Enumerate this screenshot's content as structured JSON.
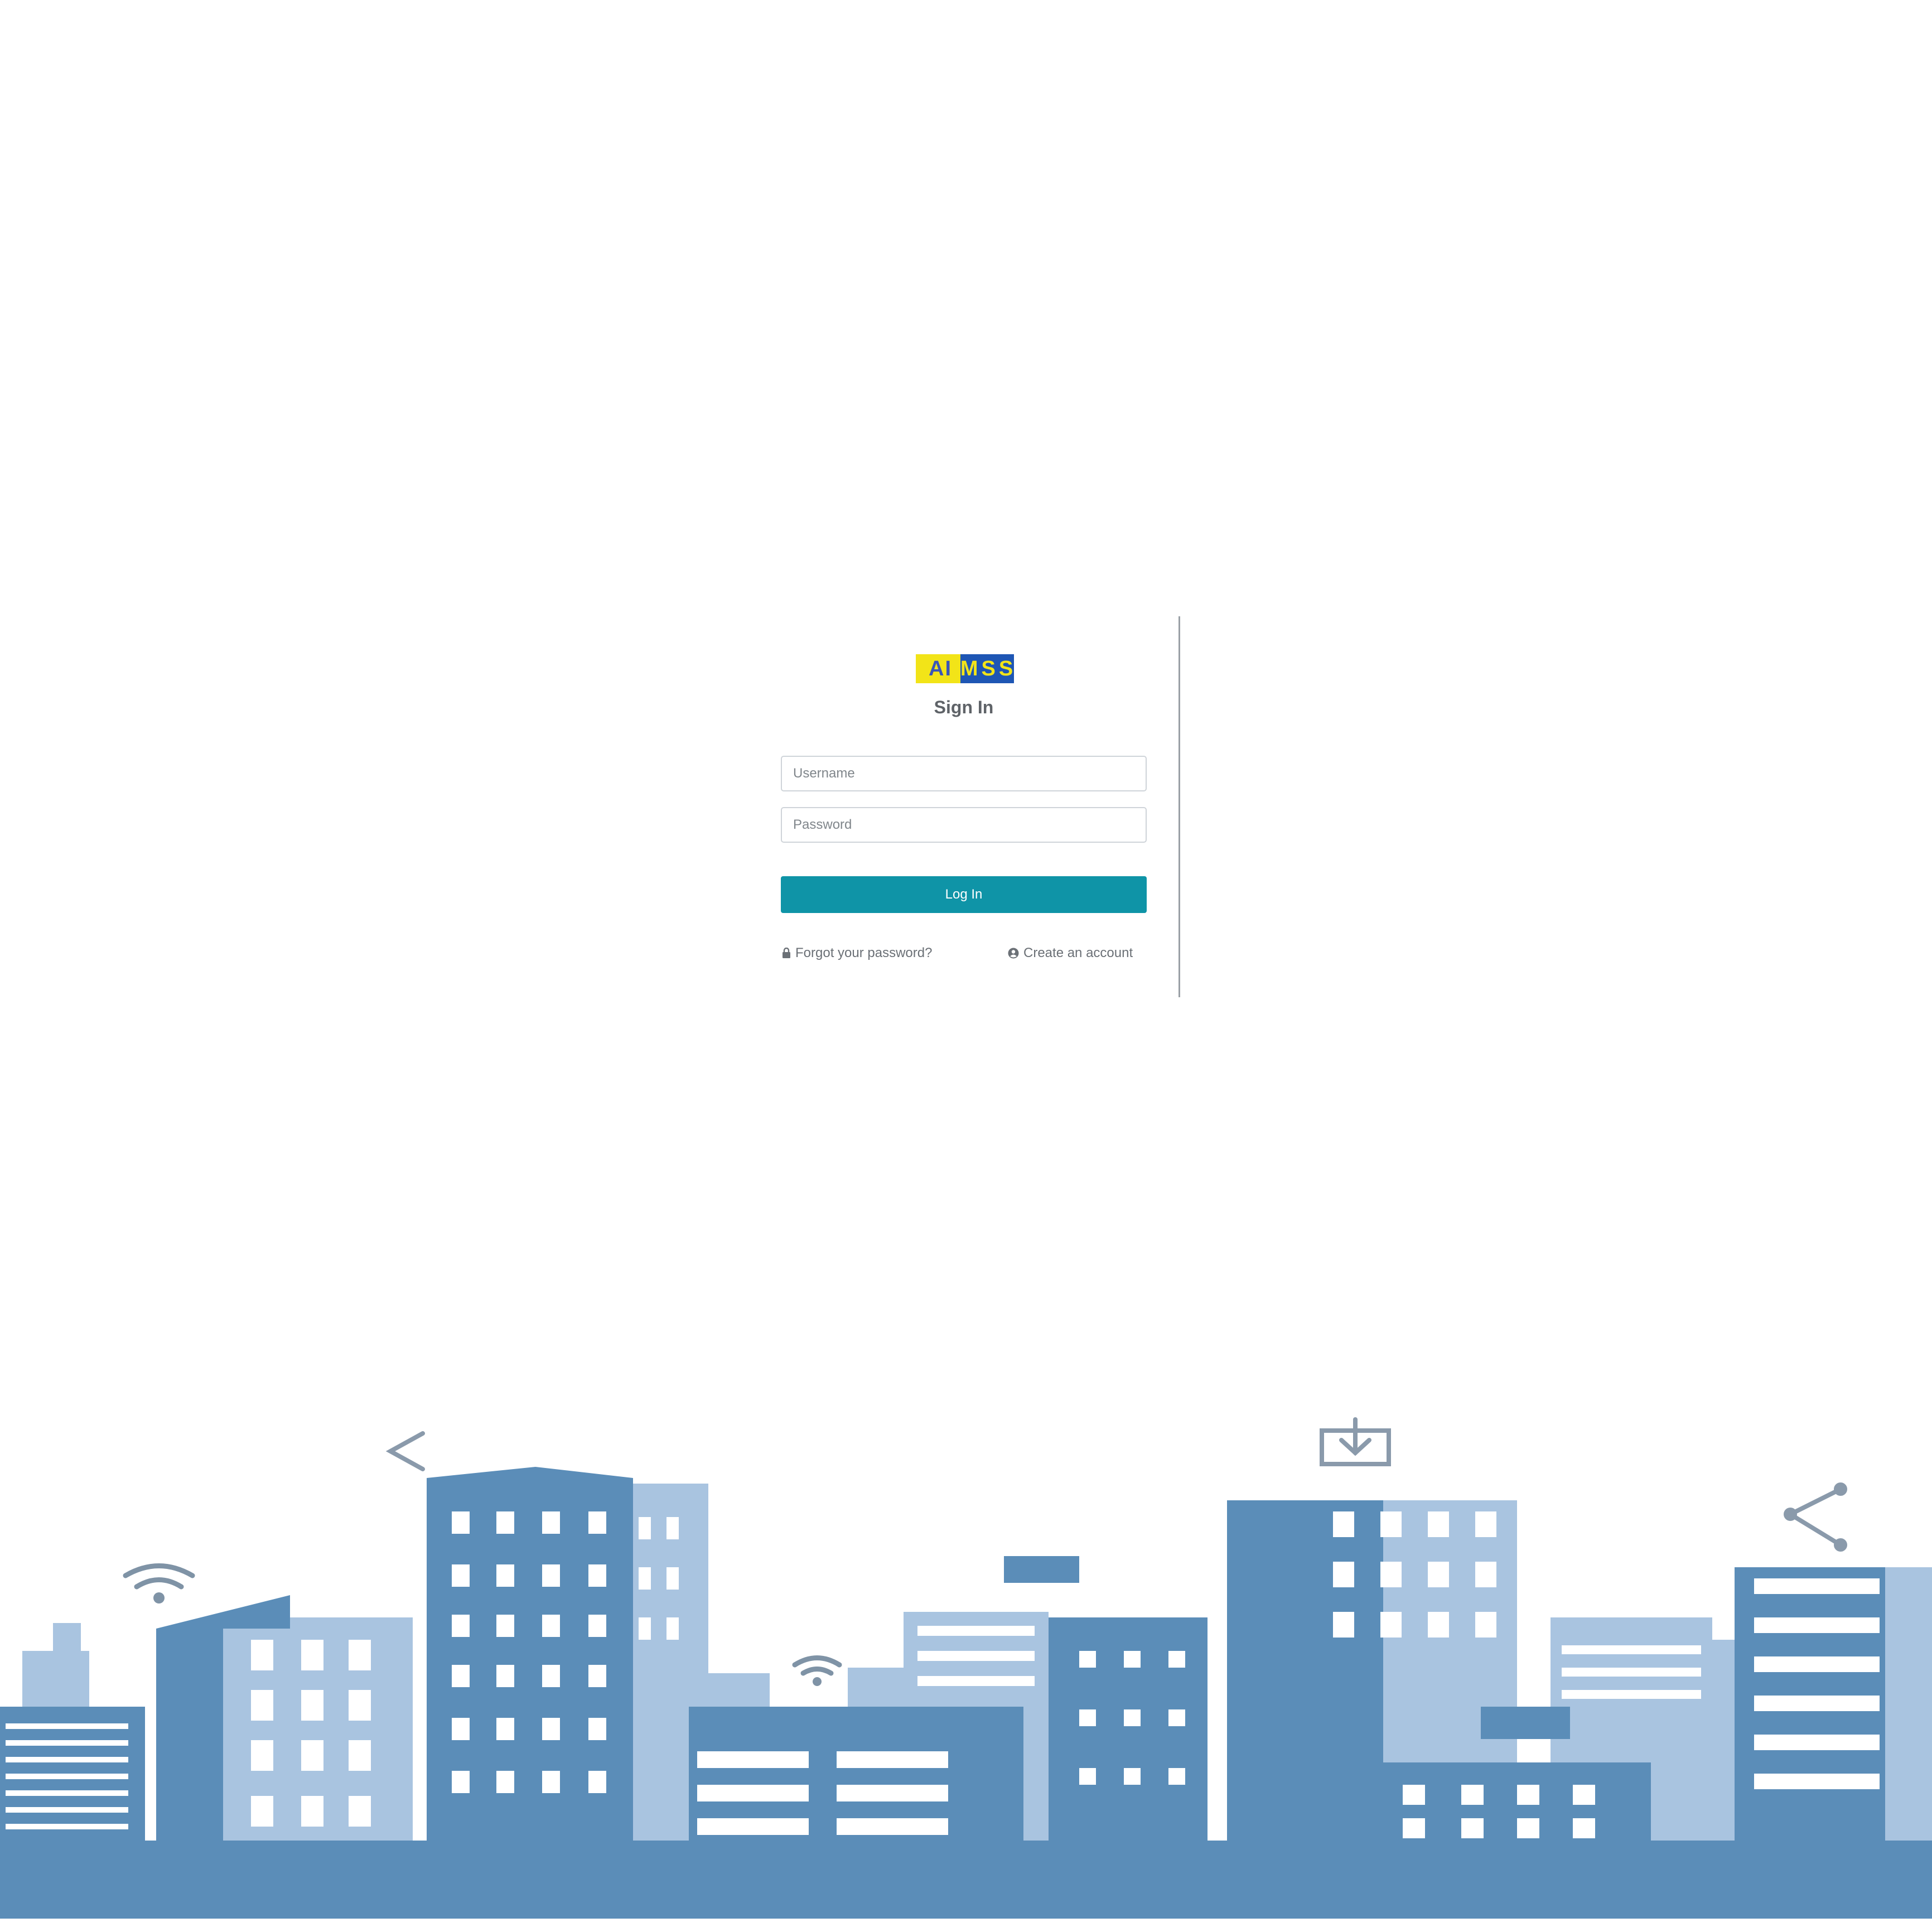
{
  "logo": {
    "left_text": "AI",
    "right_text": "MSS",
    "colors": {
      "yellow": "#f2e418",
      "blue": "#1e56b4"
    }
  },
  "signin": {
    "title": "Sign In",
    "username_placeholder": "Username",
    "password_placeholder": "Password",
    "login_label": "Log In",
    "forgot_label": "Forgot your password?",
    "create_label": "Create an account"
  },
  "icons": {
    "forgot": "lock-icon",
    "create": "user-circle-icon"
  },
  "colors": {
    "accent": "#0f94a7",
    "skyline_dark": "#5b8db8",
    "skyline_light": "#a9c4e0"
  }
}
